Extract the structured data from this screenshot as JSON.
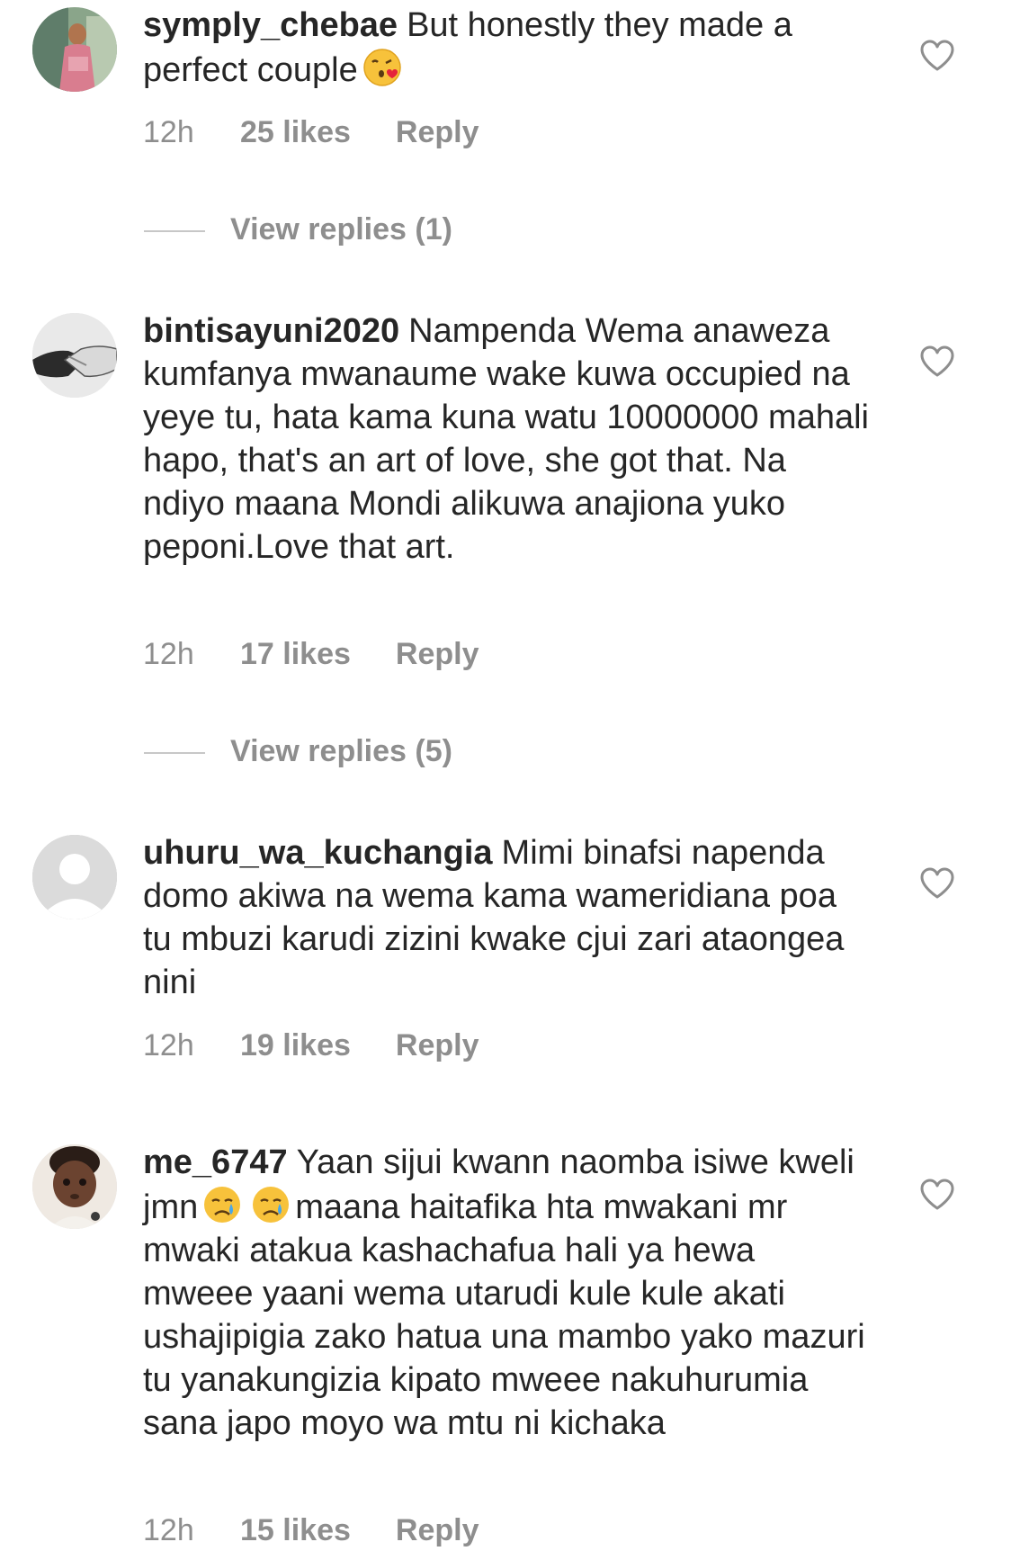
{
  "comments": [
    {
      "username": "symply_chebae",
      "text_before_emoji": "But honestly they made a perfect couple",
      "emoji": "kissing-face-heart-emoji",
      "text_after_emoji": "",
      "time": "12h",
      "likes": "25 likes",
      "reply": "Reply",
      "view_replies": "View replies (1)"
    },
    {
      "username": "bintisayuni2020",
      "text": "Nampenda Wema anaweza kumfanya mwanaume wake kuwa occupied na yeye tu, hata kama kuna watu 10000000 mahali hapo, that's an art of love, she got that. Na ndiyo maana Mondi alikuwa anajiona yuko peponi.Love that art.",
      "time": "12h",
      "likes": "17 likes",
      "reply": "Reply",
      "view_replies": "View replies (5)"
    },
    {
      "username": "uhuru_wa_kuchangia",
      "text": "Mimi binafsi napenda domo akiwa na wema kama wameridiana poa tu mbuzi karudi zizini kwake cjui zari ataongea nini",
      "time": "12h",
      "likes": "19 likes",
      "reply": "Reply"
    },
    {
      "username": "me_6747",
      "text_before_emoji": "Yaan sijui kwann naomba isiwe kweli jmn",
      "emoji": "crying-face-emoji",
      "text_after_emoji": "maana haitafika hta mwakani mr mwaki atakua kashachafua hali ya hewa mweee  yaani wema utarudi kule kule akati ushajipigia zako hatua una mambo yako mazuri tu yanakungizia kipato mweee nakuhurumia sana japo moyo wa mtu ni kichaka",
      "time": "12h",
      "likes": "15 likes",
      "reply": "Reply"
    }
  ],
  "colors": {
    "text": "#262626",
    "meta": "#8e8e8e",
    "divider": "#c7c7c7"
  }
}
